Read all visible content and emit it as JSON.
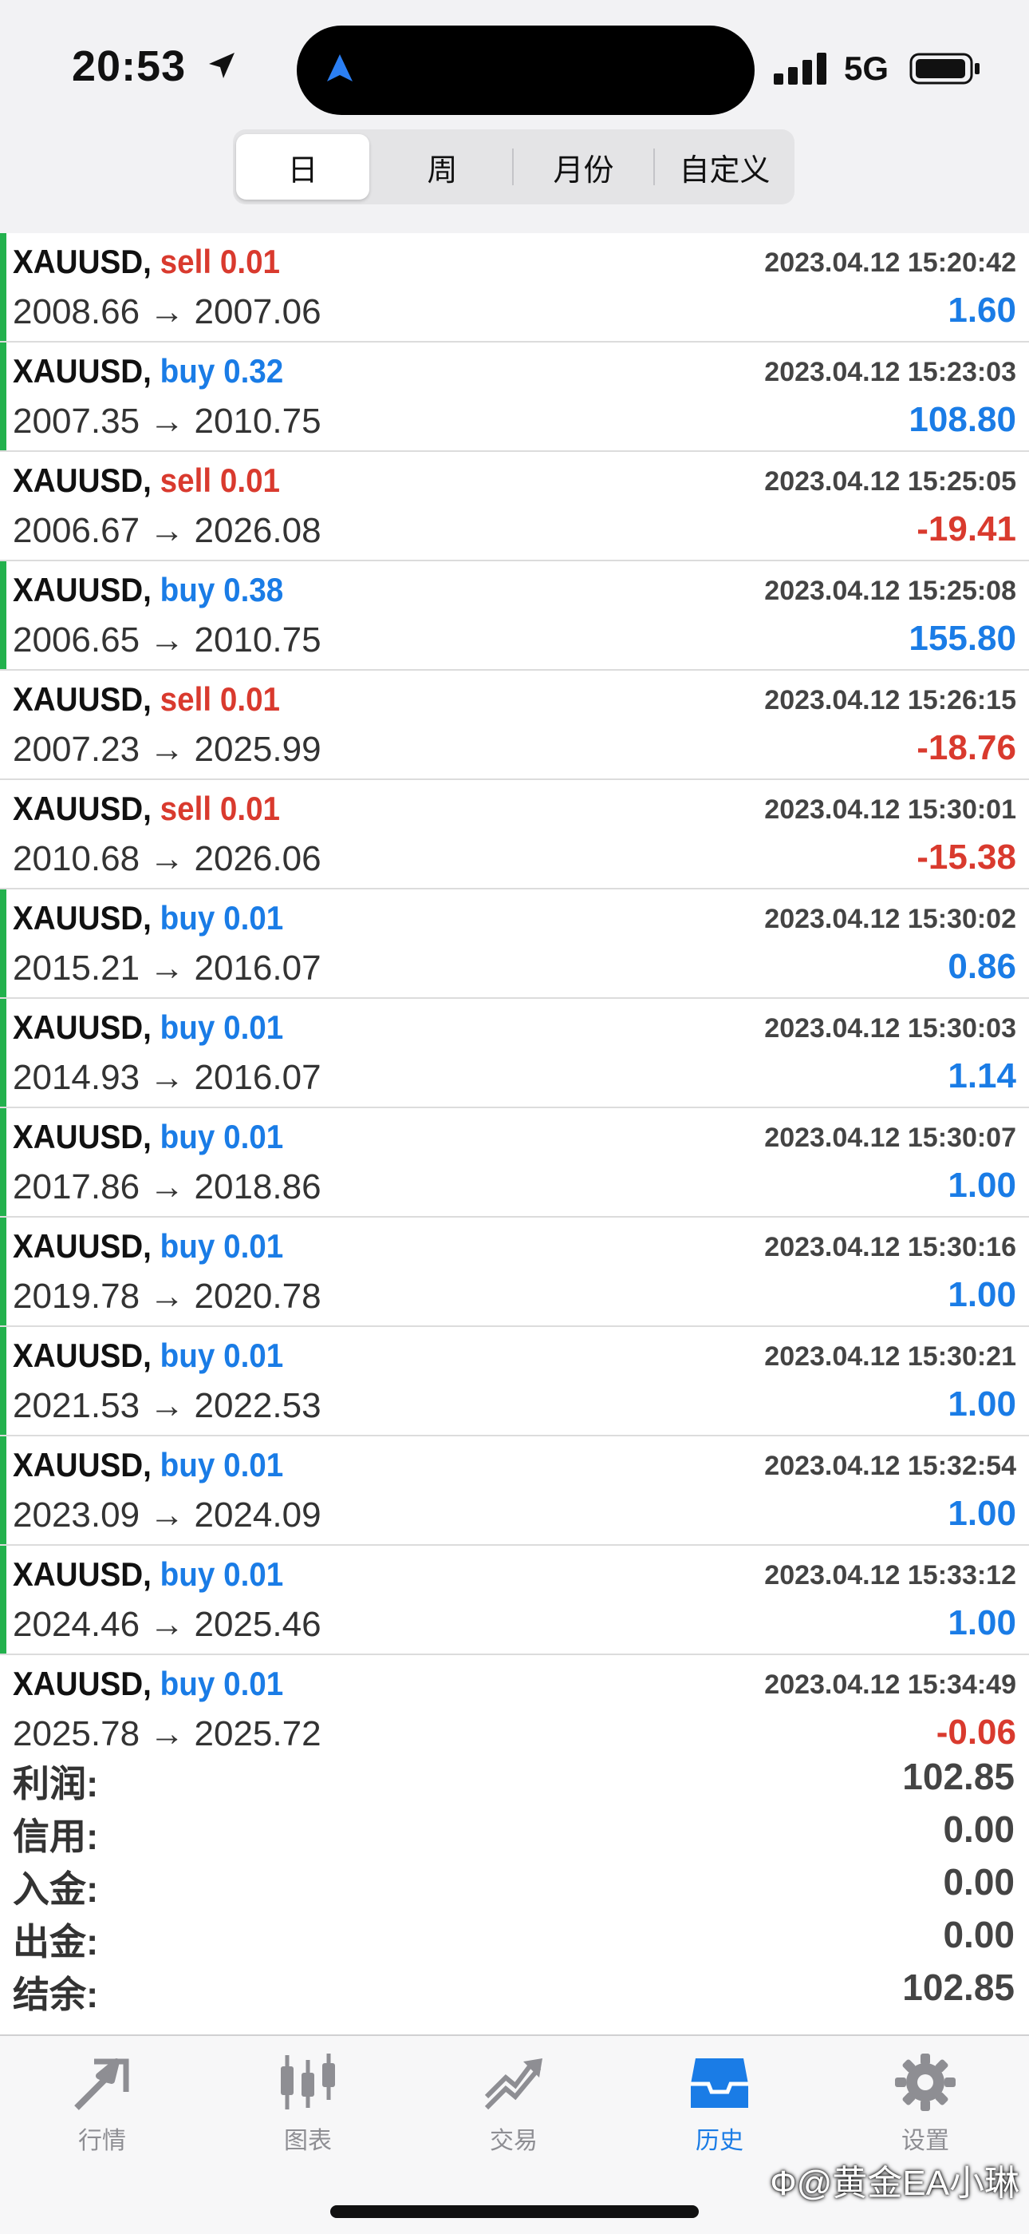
{
  "status": {
    "time": "20:53",
    "network": "5G"
  },
  "segments": [
    "日",
    "周",
    "月份",
    "自定义"
  ],
  "trades": [
    {
      "symbol": "XAUUSD,",
      "side": "sell",
      "volume": "0.01",
      "open": "2008.66",
      "close": "2007.06",
      "datetime": "2023.04.12 15:20:42",
      "profit": "1.60",
      "profit_sign": "pos"
    },
    {
      "symbol": "XAUUSD,",
      "side": "buy",
      "volume": "0.32",
      "open": "2007.35",
      "close": "2010.75",
      "datetime": "2023.04.12 15:23:03",
      "profit": "108.80",
      "profit_sign": "pos"
    },
    {
      "symbol": "XAUUSD,",
      "side": "sell",
      "volume": "0.01",
      "open": "2006.67",
      "close": "2026.08",
      "datetime": "2023.04.12 15:25:05",
      "profit": "-19.41",
      "profit_sign": "neg"
    },
    {
      "symbol": "XAUUSD,",
      "side": "buy",
      "volume": "0.38",
      "open": "2006.65",
      "close": "2010.75",
      "datetime": "2023.04.12 15:25:08",
      "profit": "155.80",
      "profit_sign": "pos"
    },
    {
      "symbol": "XAUUSD,",
      "side": "sell",
      "volume": "0.01",
      "open": "2007.23",
      "close": "2025.99",
      "datetime": "2023.04.12 15:26:15",
      "profit": "-18.76",
      "profit_sign": "neg"
    },
    {
      "symbol": "XAUUSD,",
      "side": "sell",
      "volume": "0.01",
      "open": "2010.68",
      "close": "2026.06",
      "datetime": "2023.04.12 15:30:01",
      "profit": "-15.38",
      "profit_sign": "neg"
    },
    {
      "symbol": "XAUUSD,",
      "side": "buy",
      "volume": "0.01",
      "open": "2015.21",
      "close": "2016.07",
      "datetime": "2023.04.12 15:30:02",
      "profit": "0.86",
      "profit_sign": "pos"
    },
    {
      "symbol": "XAUUSD,",
      "side": "buy",
      "volume": "0.01",
      "open": "2014.93",
      "close": "2016.07",
      "datetime": "2023.04.12 15:30:03",
      "profit": "1.14",
      "profit_sign": "pos"
    },
    {
      "symbol": "XAUUSD,",
      "side": "buy",
      "volume": "0.01",
      "open": "2017.86",
      "close": "2018.86",
      "datetime": "2023.04.12 15:30:07",
      "profit": "1.00",
      "profit_sign": "pos"
    },
    {
      "symbol": "XAUUSD,",
      "side": "buy",
      "volume": "0.01",
      "open": "2019.78",
      "close": "2020.78",
      "datetime": "2023.04.12 15:30:16",
      "profit": "1.00",
      "profit_sign": "pos"
    },
    {
      "symbol": "XAUUSD,",
      "side": "buy",
      "volume": "0.01",
      "open": "2021.53",
      "close": "2022.53",
      "datetime": "2023.04.12 15:30:21",
      "profit": "1.00",
      "profit_sign": "pos"
    },
    {
      "symbol": "XAUUSD,",
      "side": "buy",
      "volume": "0.01",
      "open": "2023.09",
      "close": "2024.09",
      "datetime": "2023.04.12 15:32:54",
      "profit": "1.00",
      "profit_sign": "pos"
    },
    {
      "symbol": "XAUUSD,",
      "side": "buy",
      "volume": "0.01",
      "open": "2024.46",
      "close": "2025.46",
      "datetime": "2023.04.12 15:33:12",
      "profit": "1.00",
      "profit_sign": "pos"
    },
    {
      "symbol": "XAUUSD,",
      "side": "buy",
      "volume": "0.01",
      "open": "2025.78",
      "close": "2025.72",
      "datetime": "2023.04.12 15:34:49",
      "profit": "-0.06",
      "profit_sign": "neg"
    }
  ],
  "summary": [
    {
      "label": "利润:",
      "value": "102.85"
    },
    {
      "label": "信用:",
      "value": "0.00"
    },
    {
      "label": "入金:",
      "value": "0.00"
    },
    {
      "label": "出金:",
      "value": "0.00"
    },
    {
      "label": "结余:",
      "value": "102.85"
    }
  ],
  "tabs": [
    {
      "label": "行情",
      "icon": "quotes-icon"
    },
    {
      "label": "图表",
      "icon": "chart-icon"
    },
    {
      "label": "交易",
      "icon": "trade-icon"
    },
    {
      "label": "历史",
      "icon": "history-icon",
      "active": true
    },
    {
      "label": "设置",
      "icon": "settings-icon"
    }
  ],
  "watermark": "Ф@黄金EA小琳",
  "colors": {
    "buy": "#1a7ce6",
    "sell": "#d93a2e",
    "positive": "#1a7ce6",
    "negative": "#d93a2e",
    "green_bar": "#23b14d",
    "tab_inactive": "#8e8e93",
    "tab_active": "#1a7ce6"
  }
}
